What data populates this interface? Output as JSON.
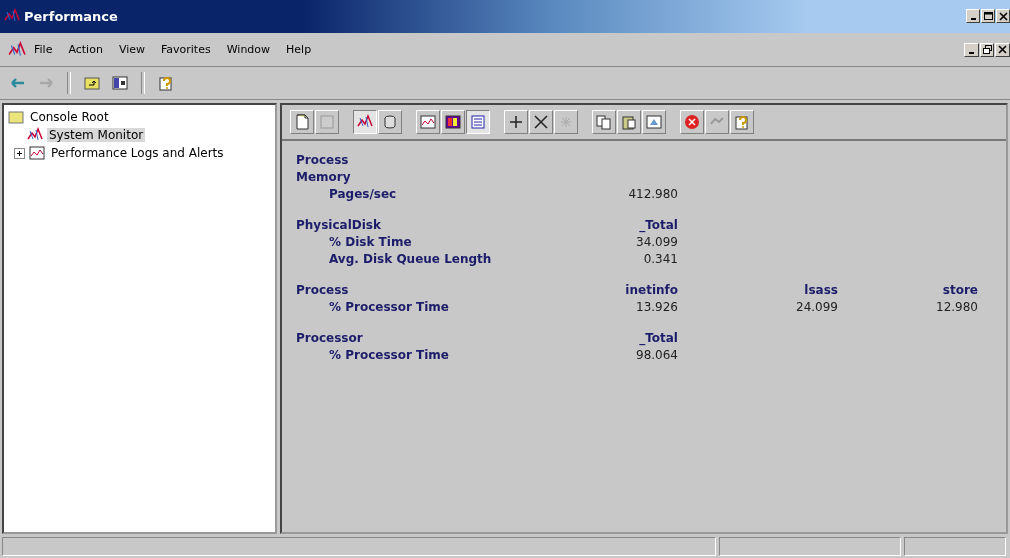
{
  "window": {
    "title": "Performance"
  },
  "menu": [
    {
      "label": "File"
    },
    {
      "label": "Action"
    },
    {
      "label": "View"
    },
    {
      "label": "Favorites"
    },
    {
      "label": "Window"
    },
    {
      "label": "Help"
    }
  ],
  "tree": [
    {
      "label": "Console Root",
      "selected": false,
      "children": [
        {
          "label": "System Monitor",
          "selected": true
        },
        {
          "label": "Performance Logs and Alerts",
          "selected": false,
          "expanded": false
        }
      ]
    }
  ],
  "report": {
    "header": "Process",
    "objects": [
      {
        "name": "Memory",
        "counters": [
          {
            "name": "Pages/sec",
            "values": [
              "412.980"
            ]
          }
        ]
      },
      {
        "name": "PhysicalDisk",
        "instances": [
          "_Total"
        ],
        "counters": [
          {
            "name": "% Disk Time",
            "values": [
              "34.099"
            ]
          },
          {
            "name": "Avg. Disk Queue Length",
            "values": [
              "0.341"
            ]
          }
        ]
      },
      {
        "name": "Process",
        "instances": [
          "inetinfo",
          "lsass",
          "store"
        ],
        "counters": [
          {
            "name": "% Processor Time",
            "values": [
              "13.926",
              "24.099",
              "12.980"
            ]
          }
        ]
      },
      {
        "name": "Processor",
        "instances": [
          "_Total"
        ],
        "counters": [
          {
            "name": "% Processor Time",
            "values": [
              "98.064"
            ]
          }
        ]
      }
    ]
  }
}
